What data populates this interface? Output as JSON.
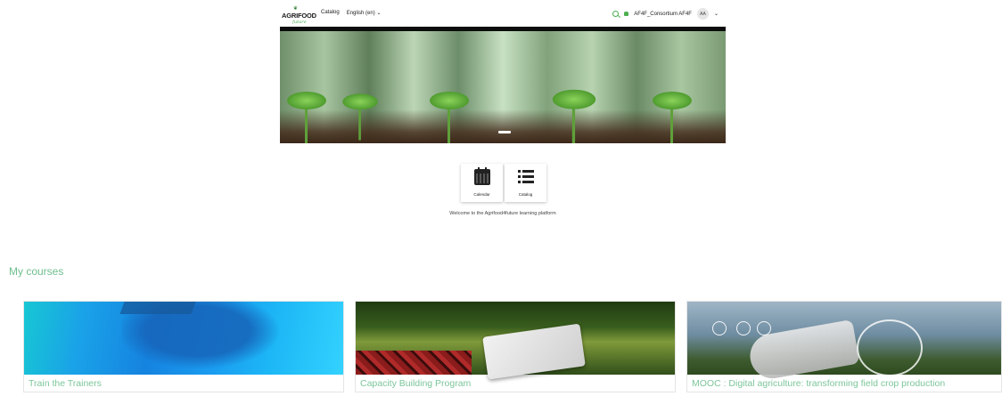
{
  "header": {
    "logo": {
      "brand": "AGRIFOOD",
      "tagline": "future"
    },
    "nav": [
      {
        "label": "Catalog"
      },
      {
        "label": "English (en)",
        "has_dropdown": true
      }
    ],
    "user": {
      "name": "AF4F_Consortium AF4F",
      "initials": "AA"
    },
    "icons": {
      "search": "search-icon",
      "notifications": "bell-icon",
      "user_menu": "chevron-down-icon"
    }
  },
  "hero": {
    "active_slide": 1
  },
  "quick_links": [
    {
      "label": "Calendar",
      "icon": "calendar-icon"
    },
    {
      "label": "Catalog",
      "icon": "list-icon"
    }
  ],
  "welcome": "Welcome to the Agrifood4future learning platform",
  "my_courses": {
    "title": "My courses",
    "items": [
      {
        "title": "Train the Trainers"
      },
      {
        "title": "Capacity Building Program"
      },
      {
        "title": "MOOC : Digital agriculture: transforming field crop production"
      }
    ]
  },
  "colors": {
    "accent": "#6fbf8f",
    "green_icon": "#4caf50"
  }
}
